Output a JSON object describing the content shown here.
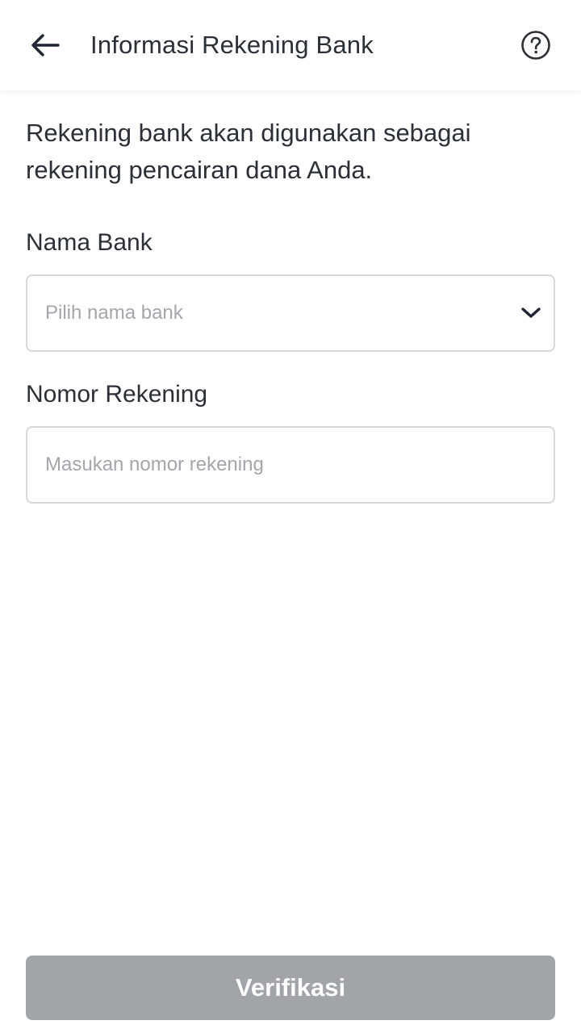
{
  "header": {
    "title": "Informasi Rekening Bank",
    "back_icon": "arrow-left-icon",
    "help_icon": "question-circle-icon"
  },
  "intro_text": "Rekening bank akan digunakan sebagai rekening pencairan dana Anda.",
  "form": {
    "bank": {
      "label": "Nama Bank",
      "placeholder": "Pilih nama bank",
      "icon": "chevron-down-icon"
    },
    "account": {
      "label": "Nomor Rekening",
      "placeholder": "Masukan nomor rekening",
      "value": ""
    }
  },
  "submit_label": "Verifikasi",
  "colors": {
    "text": "#2b2f36",
    "placeholder": "#a3a6ab",
    "border": "#d6d8dc",
    "button_disabled": "#a1a4a8"
  }
}
